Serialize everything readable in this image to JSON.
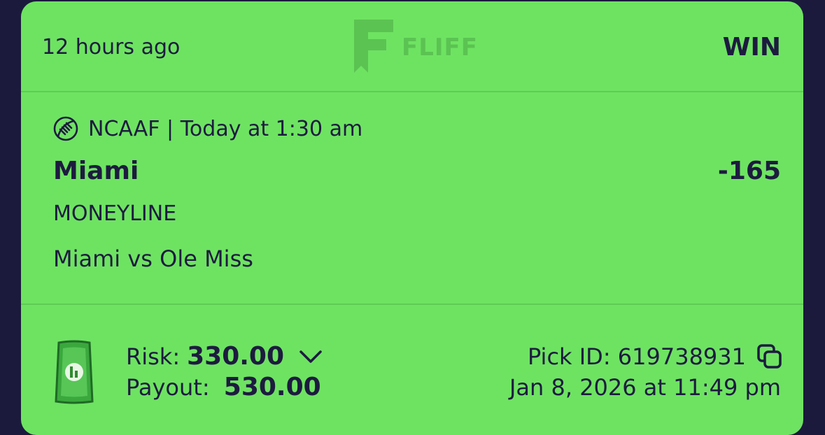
{
  "header": {
    "time_ago": "12 hours ago",
    "logo_text": "FLIFF",
    "result": "WIN"
  },
  "pick": {
    "league_line": "NCAAF | Today at 1:30 am",
    "league_icon": "football-icon",
    "team": "Miami",
    "odds": "-165",
    "bet_type": "MONEYLINE",
    "matchup": "Miami vs Ole Miss"
  },
  "footer": {
    "money_icon": "cash-icon",
    "risk_label": "Risk:",
    "risk_value": "330.00",
    "payout_label": "Payout:",
    "payout_value": "530.00",
    "pick_id_label": "Pick ID: 619738931",
    "copy_icon": "copy-icon",
    "date": "Jan 8, 2026 at 11:49 pm"
  },
  "colors": {
    "card": "#6ee362",
    "text": "#1d1b3f",
    "background": "#1b1a3d",
    "divider": "#5fcb55"
  }
}
